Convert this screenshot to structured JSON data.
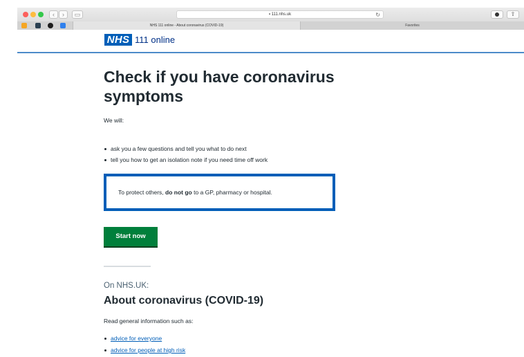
{
  "browser": {
    "address": "111.nhs.uk",
    "back_icon": "chevron-left-icon",
    "forward_icon": "chevron-right-icon",
    "reload_icon": "reload-icon",
    "active_tab": "NHS 111 online - About coronavirus (COVID-19)",
    "favorites_tab": "Favorites"
  },
  "header": {
    "logo": "NHS",
    "service_name": "111 online",
    "brand_color": "#005eb8"
  },
  "main": {
    "title": "Check if you have coronavirus symptoms",
    "intro": "We will:",
    "bullets": [
      "ask you a few questions and tell you what to do next",
      "tell you how to get an isolation note if you need time off work"
    ],
    "warning": {
      "before": "To protect others, ",
      "emphasis": "do not go",
      "after": " to a GP, pharmacy or hospital."
    },
    "start_button": "Start now",
    "start_color": "#007f3b"
  },
  "more_info": {
    "caption": "On NHS.UK:",
    "heading": "About coronavirus (COVID-19)",
    "text": "Read general information such as:",
    "links": [
      "advice for everyone",
      "advice for people at high risk"
    ]
  }
}
